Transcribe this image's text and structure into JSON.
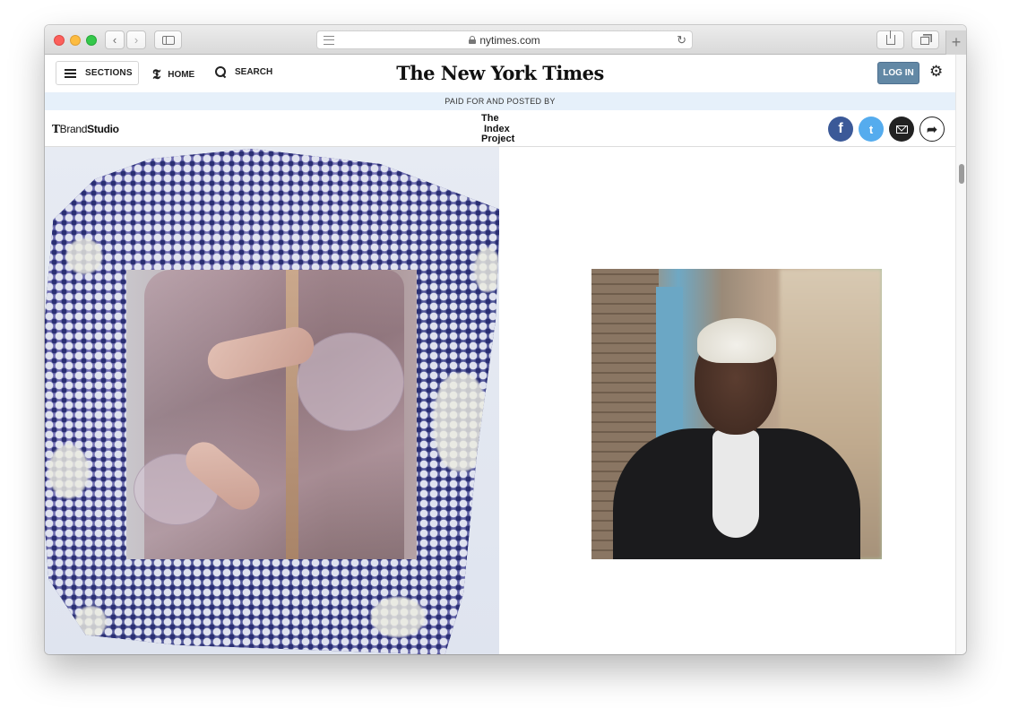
{
  "browser": {
    "url": "nytimes.com",
    "icons": [
      "back-icon",
      "forward-icon",
      "sidebar-icon",
      "reader-icon",
      "lock-icon",
      "reload-icon",
      "share-icon",
      "tabs-icon",
      "new-tab-icon"
    ]
  },
  "header": {
    "sections_label": "SECTIONS",
    "home_label": "HOME",
    "search_label": "SEARCH",
    "logo_text": "The New York Times",
    "login_label": "LOG IN",
    "login_color": "#6288a5"
  },
  "banner": {
    "paid_text": "PAID FOR AND POSTED BY",
    "background": "#e6f0fa"
  },
  "brand_bar": {
    "brand_t": "T",
    "brand_left": "Brand",
    "brand_right": "Studio",
    "sponsor_line1": "The",
    "sponsor_line2": "Index",
    "sponsor_line3": "Project",
    "share": {
      "facebook_glyph": "f",
      "twitter_glyph": "t",
      "more_glyph": "➦",
      "facebook_color": "#3b5998",
      "twitter_color": "#55acee"
    }
  },
  "content": {
    "left_image": "textile-garment-collage",
    "right_image": "portrait-woman-street"
  }
}
